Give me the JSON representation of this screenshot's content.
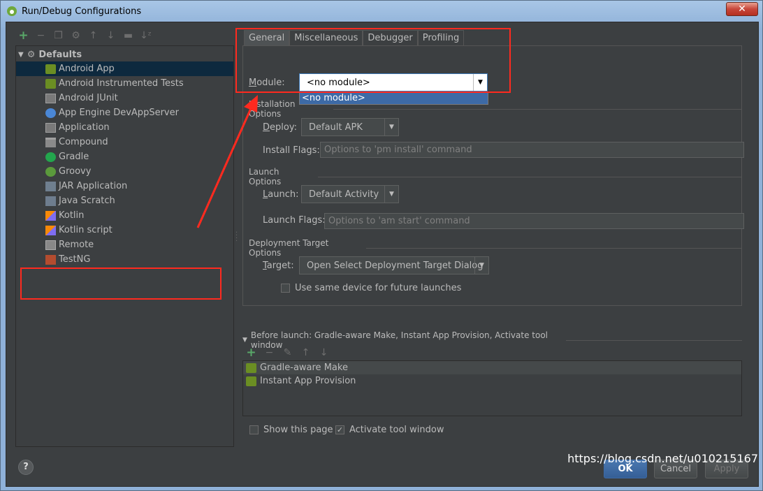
{
  "window": {
    "title": "Run/Debug Configurations",
    "close_label": "✕"
  },
  "left_toolbar": {
    "icons": [
      "add-icon",
      "remove-icon",
      "copy-icon",
      "edit-defaults-icon",
      "move-up-icon",
      "move-down-icon",
      "folder-icon",
      "sort-icon"
    ]
  },
  "tree": {
    "root_label": "Defaults",
    "items": [
      {
        "label": "Android App",
        "icon": "android-app-icon"
      },
      {
        "label": "Android Instrumented Tests",
        "icon": "android-tests-icon"
      },
      {
        "label": "Android JUnit",
        "icon": "android-junit-icon"
      },
      {
        "label": "App Engine DevAppServer",
        "icon": "app-engine-icon"
      },
      {
        "label": "Application",
        "icon": "application-icon"
      },
      {
        "label": "Compound",
        "icon": "compound-icon"
      },
      {
        "label": "Gradle",
        "icon": "gradle-icon"
      },
      {
        "label": "Groovy",
        "icon": "groovy-icon"
      },
      {
        "label": "JAR Application",
        "icon": "jar-icon"
      },
      {
        "label": "Java Scratch",
        "icon": "java-scratch-icon"
      },
      {
        "label": "Kotlin",
        "icon": "kotlin-icon"
      },
      {
        "label": "Kotlin script",
        "icon": "kotlin-script-icon"
      },
      {
        "label": "Remote",
        "icon": "remote-icon"
      },
      {
        "label": "TestNG",
        "icon": "testng-icon"
      }
    ]
  },
  "tabs": [
    "General",
    "Miscellaneous",
    "Debugger",
    "Profiling"
  ],
  "general": {
    "module_label_u": "M",
    "module_label_rest": "odule:",
    "module_value": "<no module>",
    "module_dropdown_option": "<no module>",
    "installation_options": "Installation Options",
    "deploy_label_u": "D",
    "deploy_label_rest": "eploy:",
    "deploy_value": "Default APK",
    "install_flags_label": "Install Flags:",
    "install_flags_placeholder": "Options to 'pm install' command",
    "launch_options": "Launch Options",
    "launch_label_u": "L",
    "launch_label_rest": "aunch:",
    "launch_value": "Default Activity",
    "launch_flags_label": "Launch Flags:",
    "launch_flags_placeholder": "Options to 'am start' command",
    "deployment_target_options": "Deployment Target Options",
    "target_label_u": "T",
    "target_label_rest": "arget:",
    "target_value": "Open Select Deployment Target Dialog",
    "same_device_label": "Use same device for future launches"
  },
  "before_launch": {
    "title": "Before launch: Gradle-aware Make, Instant App Provision, Activate tool window",
    "items": [
      "Gradle-aware Make",
      "Instant App Provision"
    ]
  },
  "footer": {
    "show_page_label": "Show this page",
    "activate_tool_window_label": "Activate tool window",
    "ok_label": "OK",
    "cancel_label": "Cancel",
    "apply_label": "Apply",
    "help_label": "?"
  },
  "watermark": "https://blog.csdn.net/u010215167",
  "colors": {
    "annotation_red": "#ff2a1f",
    "selection": "#0d293e",
    "accent": "#3d6aa6"
  }
}
